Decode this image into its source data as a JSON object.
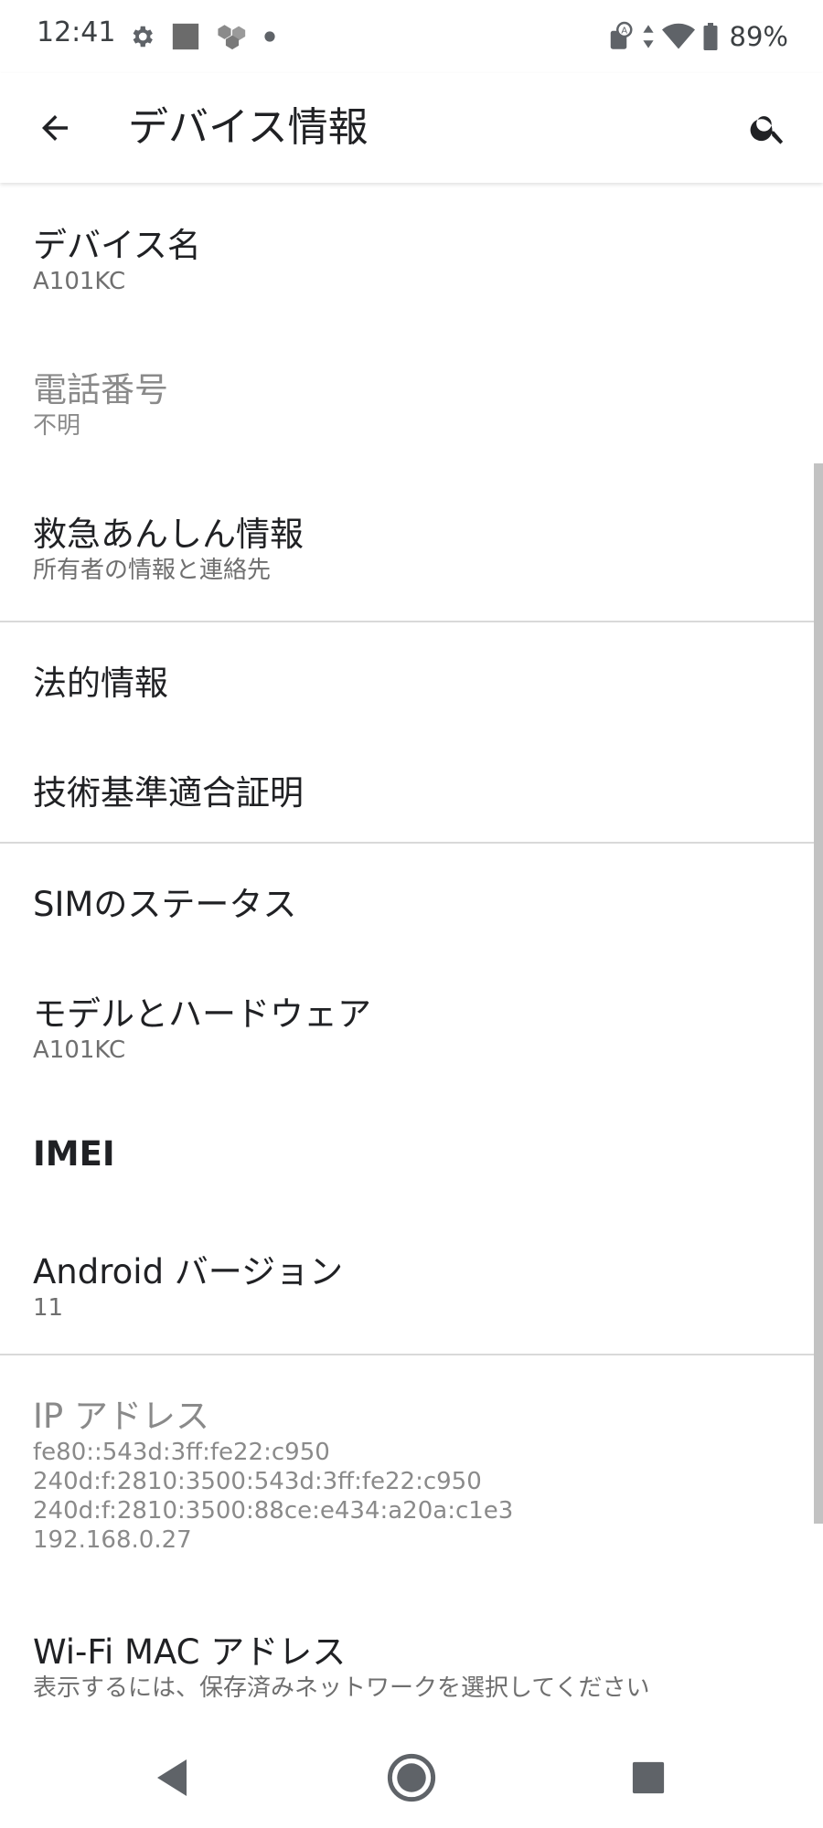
{
  "status_bar": {
    "time": "12:41",
    "battery_percent": "89%",
    "icons_left": [
      "gear-icon",
      "square-notification-icon",
      "network-icon",
      "dot-icon"
    ],
    "icons_right": [
      "data-saver-icon",
      "data-arrows-icon",
      "wifi-icon",
      "battery-icon"
    ]
  },
  "app_bar": {
    "title": "デバイス情報",
    "back_icon": "arrow-back-icon",
    "search_icon": "search-icon"
  },
  "items": [
    {
      "title": "デバイス名",
      "summary": "A101KC"
    },
    {
      "title": "電話番号",
      "summary": "不明"
    },
    {
      "title": "救急あんしん情報",
      "summary": "所有者の情報と連絡先"
    },
    {
      "title": "法的情報"
    },
    {
      "title": "技術基準適合証明"
    },
    {
      "title": "SIMのステータス"
    },
    {
      "title": "モデルとハードウェア",
      "summary": "A101KC"
    },
    {
      "title": "IMEI"
    },
    {
      "title": "Android バージョン",
      "summary": "11"
    },
    {
      "title": "IP アドレス",
      "summary_lines": [
        "fe80::543d:3ff:fe22:c950",
        "240d:f:2810:3500:543d:3ff:fe22:c950",
        "240d:f:2810:3500:88ce:e434:a20a:c1e3",
        "192.168.0.27"
      ]
    },
    {
      "title": "Wi-Fi MAC アドレス",
      "summary": "表示するには、保存済みネットワークを選択してください"
    }
  ],
  "nav_bar": {
    "back": "nav-back-icon",
    "home": "nav-home-icon",
    "recents": "nav-recents-icon"
  }
}
